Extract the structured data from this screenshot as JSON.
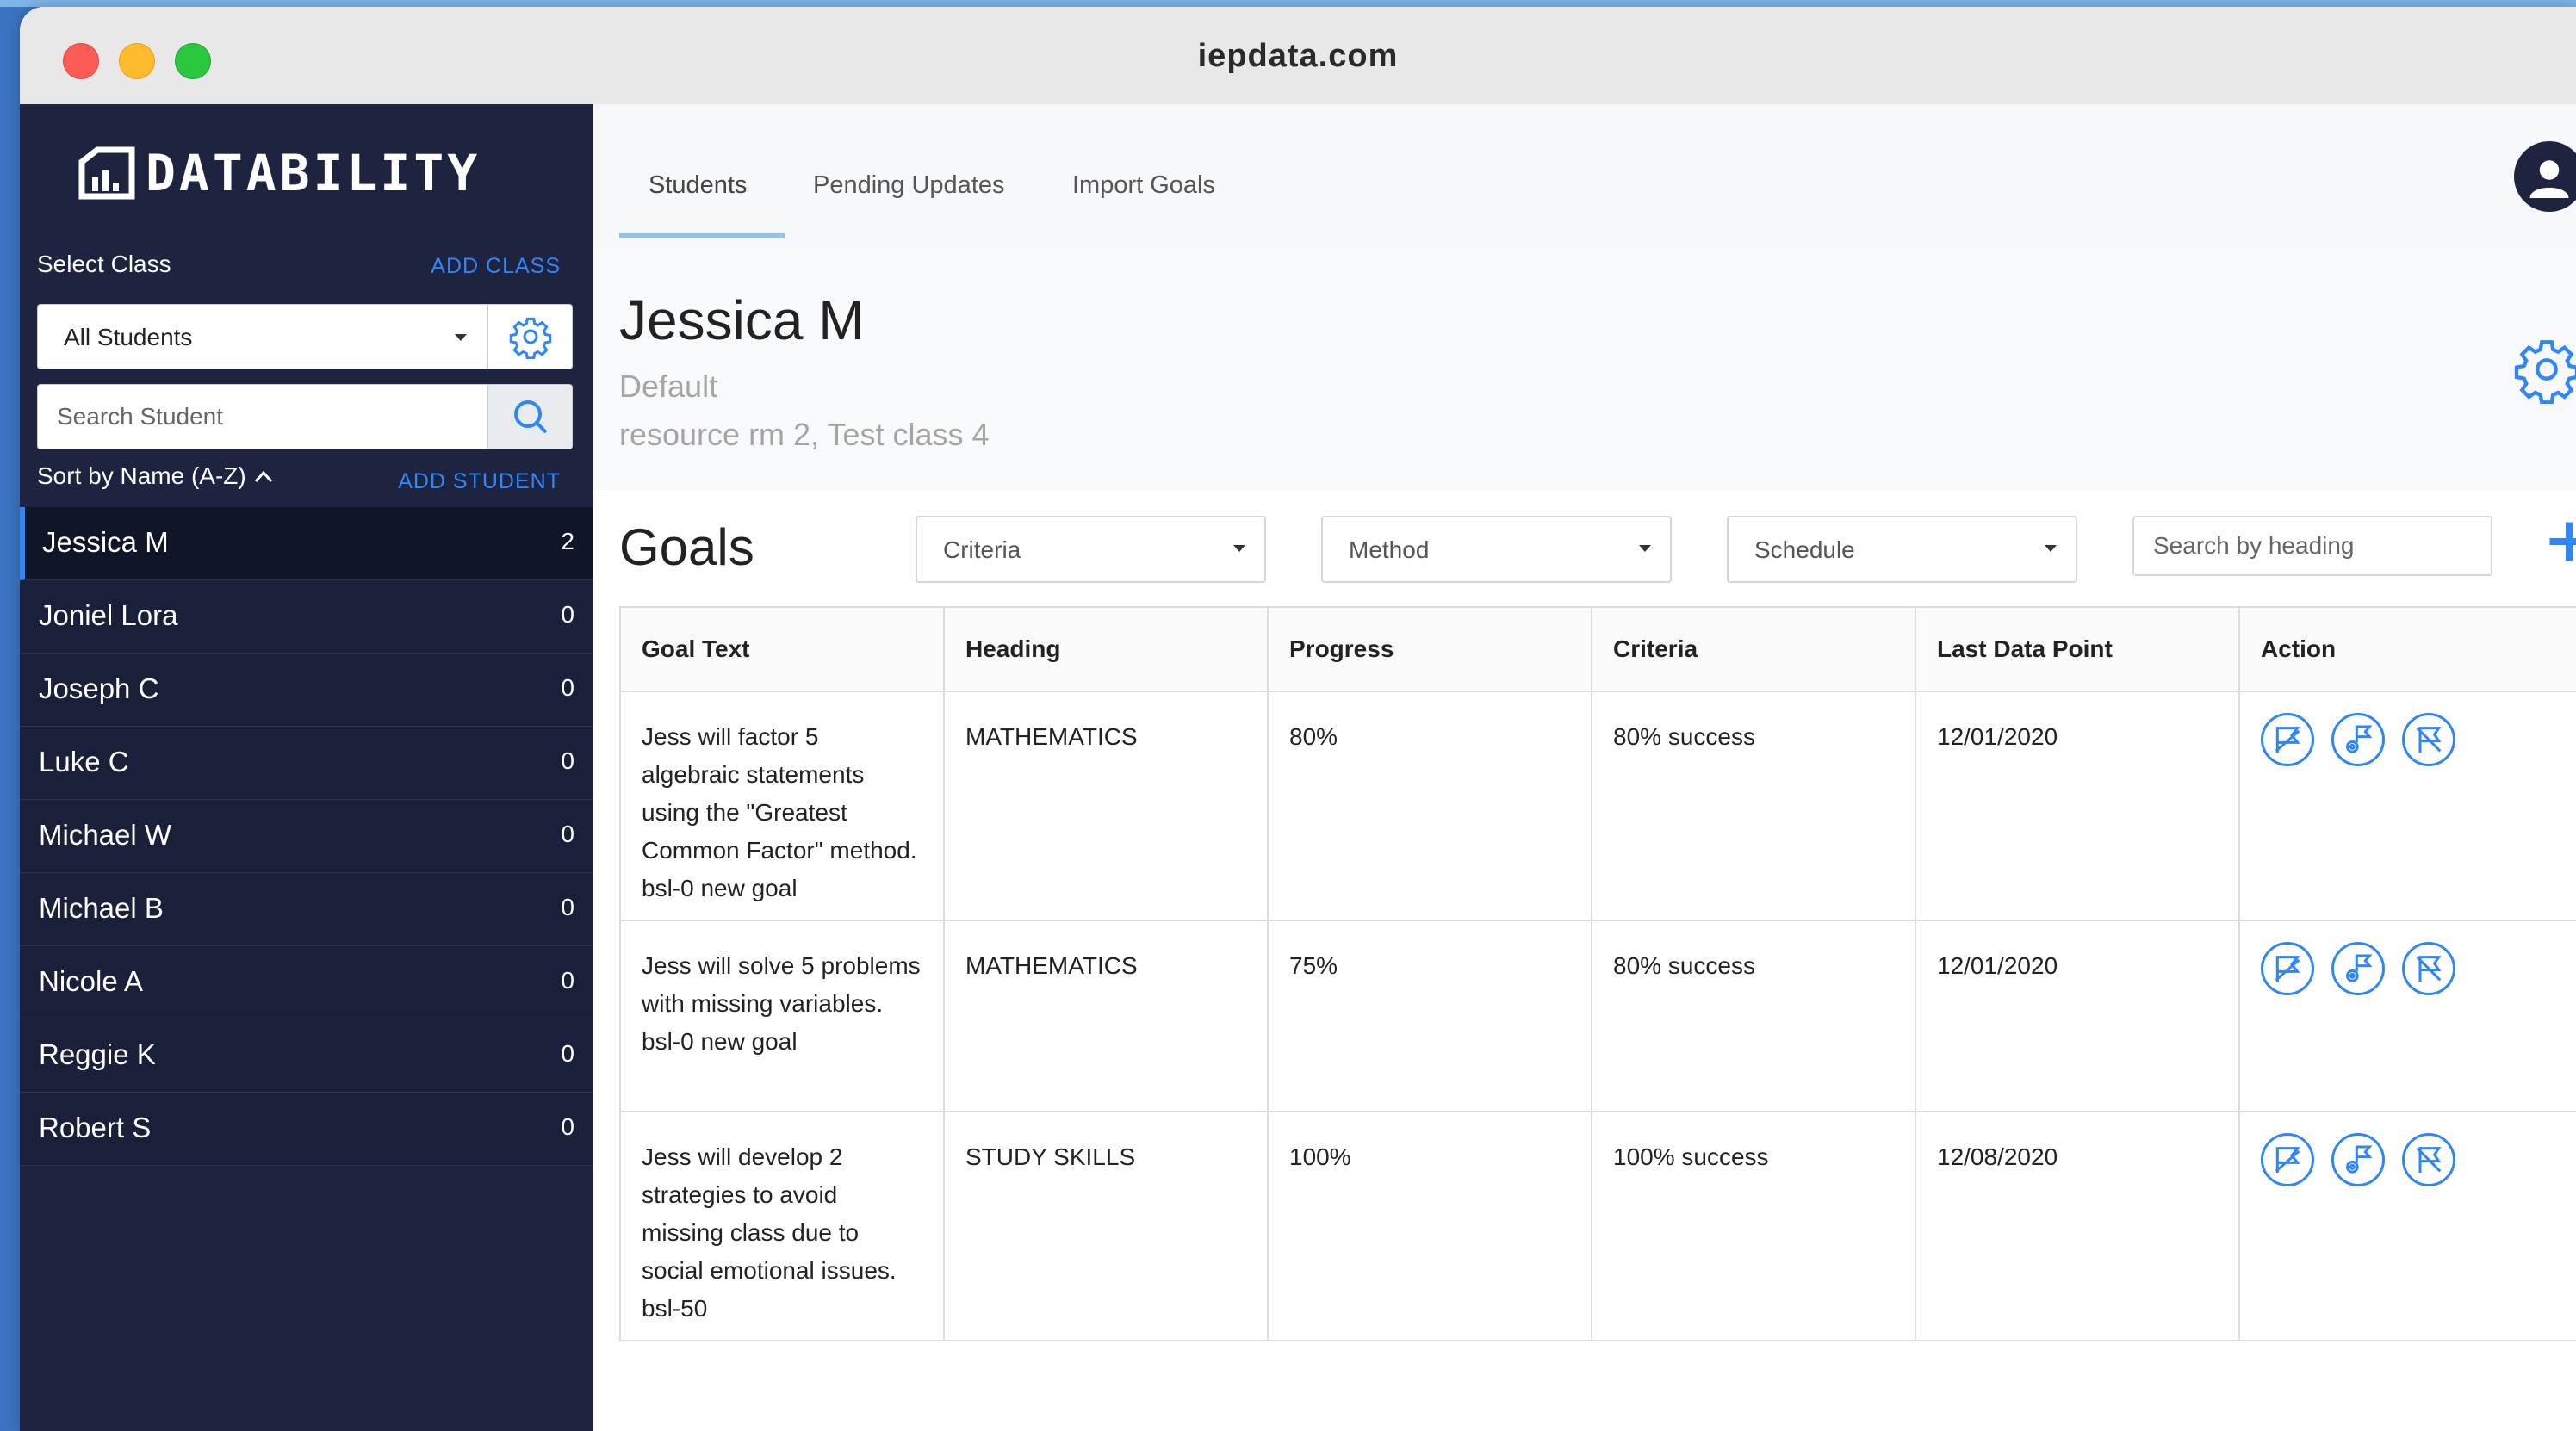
{
  "browser": {
    "url": "iepdata.com"
  },
  "sidebar": {
    "logo_text": "DATABILITY",
    "select_class_label": "Select Class",
    "add_class_label": "ADD CLASS",
    "class_select_value": "All Students",
    "search_placeholder": "Search Student",
    "sort_label": "Sort by Name (A-Z)",
    "add_student_label": "ADD STUDENT",
    "students": [
      {
        "name": "Jessica M",
        "count": "2"
      },
      {
        "name": "Joniel Lora",
        "count": "0"
      },
      {
        "name": "Joseph C",
        "count": "0"
      },
      {
        "name": "Luke C",
        "count": "0"
      },
      {
        "name": "Michael W",
        "count": "0"
      },
      {
        "name": "Michael B",
        "count": "0"
      },
      {
        "name": "Nicole A",
        "count": "0"
      },
      {
        "name": "Reggie K",
        "count": "0"
      },
      {
        "name": "Robert S",
        "count": "0"
      }
    ]
  },
  "nav": {
    "tabs": [
      {
        "label": "Students"
      },
      {
        "label": "Pending Updates"
      },
      {
        "label": "Import Goals"
      }
    ]
  },
  "student": {
    "name": "Jessica M",
    "subtitle": "Default",
    "classes": "resource rm 2, Test class 4"
  },
  "goals": {
    "title": "Goals",
    "filters": {
      "criteria": "Criteria",
      "method": "Method",
      "schedule": "Schedule"
    },
    "search_placeholder": "Search by heading",
    "columns": [
      "Goal Text",
      "Heading",
      "Progress",
      "Criteria",
      "Last Data Point",
      "Action"
    ],
    "rows": [
      {
        "text": "Jess will factor 5 algebraic statements using the \"Greatest Common Factor\" method. bsl-0 new goal",
        "heading": "MATHEMATICS",
        "progress": "80%",
        "criteria": "80% success",
        "last": "12/01/2020"
      },
      {
        "text": "Jess will solve 5 problems with missing variables. bsl-0 new goal",
        "heading": "MATHEMATICS",
        "progress": "75%",
        "criteria": "80% success",
        "last": "12/01/2020"
      },
      {
        "text": "Jess will develop 2 strategies to avoid missing class due to social emotional issues. bsl-50",
        "heading": "STUDY SKILLS",
        "progress": "100%",
        "criteria": "100% success",
        "last": "12/08/2020"
      }
    ]
  },
  "colors": {
    "sidebar_bg": "#1e2440",
    "accent": "#2f86f6",
    "desktop_bg": "#3b74c2"
  },
  "icons": {
    "logo": "datability-logo-icon",
    "gear": "gear-icon",
    "search": "search-icon",
    "avatar": "user-icon",
    "add": "plus-icon",
    "actions": [
      "chart-flag-icon",
      "gear-flag-icon",
      "close-flag-icon"
    ]
  }
}
